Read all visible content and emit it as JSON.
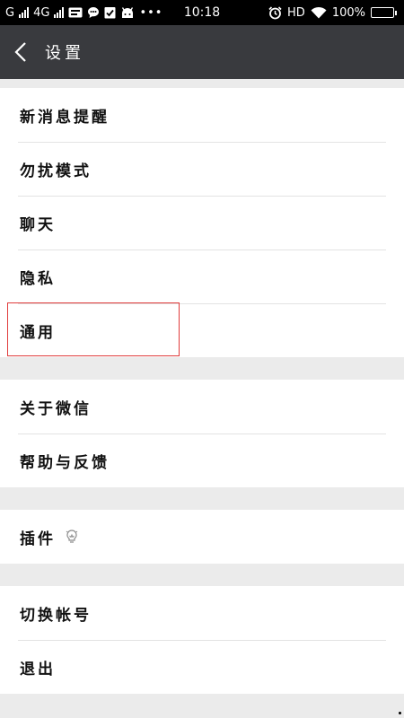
{
  "status_bar": {
    "carrier1": "G",
    "carrier2": "4G",
    "time": "10:18",
    "hd": "HD",
    "battery": "100%",
    "battery_level": 1.0
  },
  "header": {
    "title": "设置"
  },
  "groups": [
    {
      "items": [
        {
          "label": "新消息提醒"
        },
        {
          "label": "勿扰模式"
        },
        {
          "label": "聊天"
        },
        {
          "label": "隐私"
        },
        {
          "label": "通用"
        }
      ]
    },
    {
      "items": [
        {
          "label": "关于微信"
        },
        {
          "label": "帮助与反馈"
        }
      ]
    },
    {
      "items": [
        {
          "label": "插件"
        }
      ]
    },
    {
      "items": [
        {
          "label": "切换帐号"
        },
        {
          "label": "退出"
        }
      ]
    }
  ],
  "colors": {
    "title_bar": "#393a3e",
    "background": "#ebebeb",
    "highlight": "#e03b3b"
  },
  "icons": [
    "back-arrow-icon",
    "signal-icon",
    "chat-icon",
    "check-icon",
    "android-icon",
    "alarm-icon",
    "wifi-icon",
    "battery-icon",
    "plugin-bulb-icon"
  ]
}
